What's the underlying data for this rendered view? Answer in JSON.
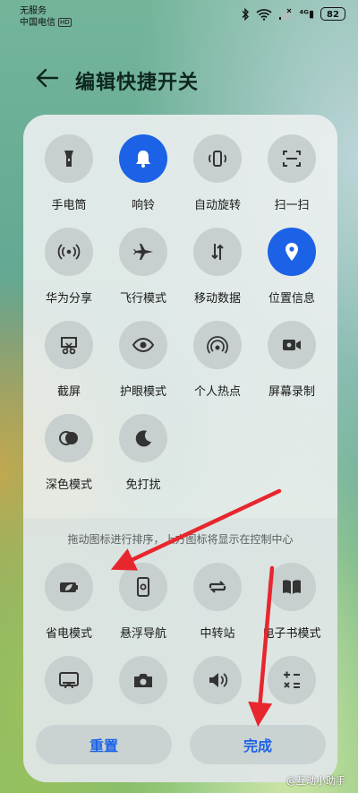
{
  "status_bar": {
    "carrier_line1": "无服务",
    "carrier_line2": "中国电信",
    "hd_badge": "HD",
    "battery": "82"
  },
  "header": {
    "title": "编辑快捷开关",
    "back_icon": "arrow-left-icon"
  },
  "active_tiles": [
    {
      "label": "手电筒",
      "icon": "flashlight-icon",
      "on": false
    },
    {
      "label": "响铃",
      "icon": "bell-icon",
      "on": true
    },
    {
      "label": "自动旋转",
      "icon": "auto-rotate-icon",
      "on": false
    },
    {
      "label": "扫一扫",
      "icon": "scan-icon",
      "on": false
    },
    {
      "label": "华为分享",
      "icon": "huawei-share-icon",
      "on": false
    },
    {
      "label": "飞行模式",
      "icon": "airplane-icon",
      "on": false
    },
    {
      "label": "移动数据",
      "icon": "mobile-data-icon",
      "on": false
    },
    {
      "label": "位置信息",
      "icon": "location-icon",
      "on": true
    },
    {
      "label": "截屏",
      "icon": "screenshot-icon",
      "on": false
    },
    {
      "label": "护眼模式",
      "icon": "eye-icon",
      "on": false
    },
    {
      "label": "个人热点",
      "icon": "hotspot-icon",
      "on": false
    },
    {
      "label": "屏幕录制",
      "icon": "screen-record-icon",
      "on": false
    },
    {
      "label": "深色模式",
      "icon": "dark-mode-icon",
      "on": false
    },
    {
      "label": "免打扰",
      "icon": "moon-icon",
      "on": false
    }
  ],
  "hint": "拖动图标进行排序，上方图标将显示在控制中心",
  "inactive_tiles": [
    {
      "label": "省电模式",
      "icon": "battery-saver-icon"
    },
    {
      "label": "悬浮导航",
      "icon": "floating-nav-icon"
    },
    {
      "label": "中转站",
      "icon": "transfer-station-icon"
    },
    {
      "label": "电子书模式",
      "icon": "ebook-icon"
    },
    {
      "label": "",
      "icon": "cast-screen-icon"
    },
    {
      "label": "",
      "icon": "camera-icon"
    },
    {
      "label": "",
      "icon": "volume-icon"
    },
    {
      "label": "",
      "icon": "calculator-icon"
    }
  ],
  "buttons": {
    "reset": "重置",
    "done": "完成"
  },
  "watermark": "@互动小助手",
  "colors": {
    "accent": "#1c62e6",
    "annotation_arrow": "#e8262e"
  }
}
